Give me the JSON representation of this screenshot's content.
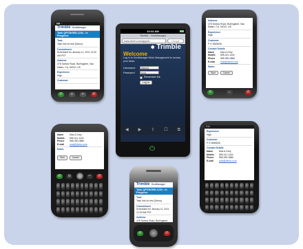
{
  "center_phone": {
    "status_time": "10:44 AM",
    "tab_title": "Trimble - GeoManager",
    "url": "www.itsell.com/apps/b...",
    "search_placeholder": "Google",
    "logo_text": "Trimble",
    "welcome": "Welcome",
    "description": "Log in to GeoManager Work Management to access your tasks",
    "username_label": "Username",
    "username_value": "Demo3",
    "password_label": "Password",
    "password_value": "••••••",
    "remember_label": "Remember Me",
    "login_button": "Log In",
    "toolbar_icons": [
      "◀",
      "▶",
      "⇪",
      "☐",
      "⧉"
    ],
    "home_icon": "⏻"
  },
  "top_left_phone": {
    "brand": "Trimble",
    "app": "GeoManager",
    "task_title": "Task QPCN/GRL1234 - In Progress",
    "rows": [
      {
        "label": "Task",
        "value": "Task Info for test (Demo)"
      },
      {
        "label": "Commitment",
        "value": "Scheduled for January 11, 2011 12:00 AM PST"
      },
      {
        "label": "Address",
        "value": "478 Santos Road, Burlingame, San Mateo, CA, 94010, US"
      },
      {
        "label": "Experience",
        "value": "High"
      },
      {
        "label": "Customer",
        "value": ""
      }
    ]
  },
  "top_right_phone": {
    "address_label": "Address",
    "address_value": "478 Santos Road, Burlingame, San Mateo, CA, 94010, US",
    "experience_label": "Experience",
    "experience_value": "High",
    "customer_label": "Customer",
    "customer_value": "P O 5545526",
    "contact_label": "Contact Details",
    "contacts": [
      {
        "k": "Name",
        "v": "Max A Grey"
      },
      {
        "k": "Mobile",
        "v": "555-411-1441"
      },
      {
        "k": "Phone",
        "v": "555-390-0880"
      },
      {
        "k": "E-mail",
        "v": "max@demo.com"
      }
    ],
    "notes_label": "Notes",
    "buttons": [
      "Start",
      "Cancel"
    ]
  },
  "bottom_left_phone": {
    "contacts": [
      {
        "k": "Name",
        "v": "Max A Grey"
      },
      {
        "k": "Mobile",
        "v": "555-411-1441"
      },
      {
        "k": "Phone",
        "v": "555-390-0880"
      },
      {
        "k": "E-mail",
        "v": "max@demo.com"
      }
    ],
    "notes_label": "Notes",
    "buttons": [
      "Start",
      "Cancel"
    ]
  },
  "bottom_right_phone": {
    "status": "9:41",
    "experience_label": "Experience",
    "experience_value": "High",
    "customer_label": "Customer",
    "customer_value": "P O 5545526",
    "contact_label": "Contact Details",
    "contacts": [
      {
        "k": "Name",
        "v": "Max A Grey"
      },
      {
        "k": "Mobile",
        "v": "555-411-1441"
      },
      {
        "k": "Phone",
        "v": "555-390-0880"
      },
      {
        "k": "E-mail",
        "v": "max@demo.com"
      }
    ]
  },
  "bottom_center_phone": {
    "brand": "Trimble",
    "app": "GeoManager",
    "task_title": "Task QPCN/GRL1234 - In Progress",
    "rows": [
      {
        "label": "Task",
        "value": "Task Info for test (Demo)"
      },
      {
        "label": "Commitment",
        "value": "Scheduled for January 11, 2011 12:00 AM PST"
      },
      {
        "label": "Address",
        "value": "478 Santos Road, Burlingame, San Mateo, CA, 94010, US"
      }
    ]
  }
}
